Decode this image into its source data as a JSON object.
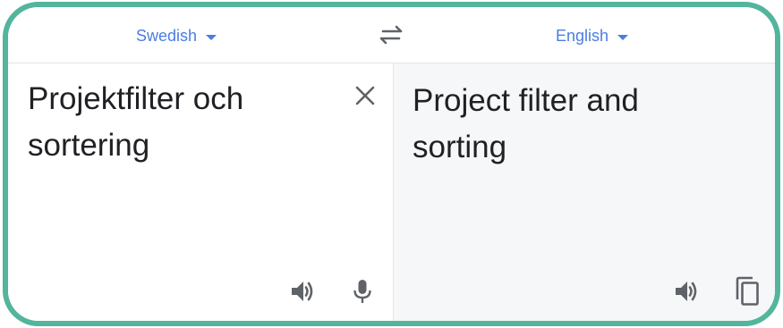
{
  "source_language": "Swedish",
  "target_language": "English",
  "source_text": "Projektfilter och sortering",
  "translated_text": "Project filter and sorting",
  "colors": {
    "frame": "#52b59c",
    "accent": "#4a7de0",
    "icon": "#5f6368",
    "target_bg": "#f6f7f9"
  },
  "icons": {
    "swap": "swap-arrows-icon",
    "clear": "close-icon",
    "speak": "speaker-icon",
    "mic": "microphone-icon",
    "copy": "copy-icon",
    "dropdown": "caret-down-icon"
  }
}
